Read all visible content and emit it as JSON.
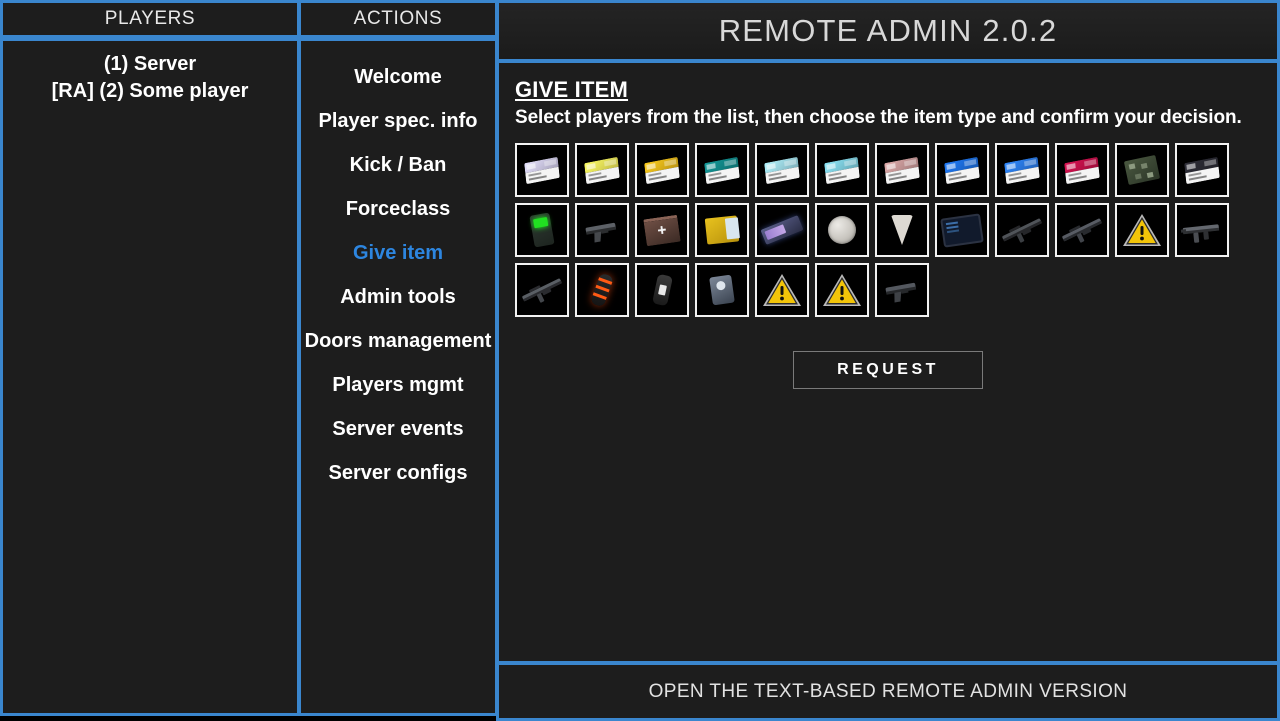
{
  "players_panel": {
    "header": "PLAYERS",
    "players": [
      {
        "label": "(1) Server"
      },
      {
        "label": "[RA] (2) Some player"
      }
    ]
  },
  "actions_panel": {
    "header": "ACTIONS",
    "items": [
      {
        "label": "Welcome",
        "active": false
      },
      {
        "label": "Player spec. info",
        "active": false
      },
      {
        "label": "Kick / Ban",
        "active": false
      },
      {
        "label": "Forceclass",
        "active": false
      },
      {
        "label": "Give item",
        "active": true
      },
      {
        "label": "Admin tools",
        "active": false
      },
      {
        "label": "Doors management",
        "active": false
      },
      {
        "label": "Players mgmt",
        "active": false
      },
      {
        "label": "Server events",
        "active": false
      },
      {
        "label": "Server configs",
        "active": false
      }
    ]
  },
  "main": {
    "title": "REMOTE ADMIN 2.0.2",
    "section_title": "GIVE ITEM",
    "section_subtitle": "Select players from the list, then choose the item type and confirm your decision.",
    "request_label": "REQUEST",
    "footer_label": "OPEN THE TEXT-BASED REMOTE ADMIN VERSION"
  },
  "theme": {
    "accent": "#3a86ce",
    "active_item": "#2d86e0",
    "panel_bg": "#1d1d1d",
    "tile_border": "#f2f2f2",
    "warning_yellow": "#f2c409"
  },
  "item_grid": {
    "columns": 12,
    "items": [
      {
        "name": "keycard-janitor",
        "art": "keycard",
        "color": "#cfcbe8"
      },
      {
        "name": "keycard-scientist",
        "art": "keycard",
        "color": "#f0e85a"
      },
      {
        "name": "keycard-research-supervisor",
        "art": "keycard",
        "color": "#e8b91a"
      },
      {
        "name": "keycard-zone-manager",
        "art": "keycard",
        "color": "#128a8a"
      },
      {
        "name": "keycard-guard",
        "art": "keycard",
        "color": "#9fdbe8"
      },
      {
        "name": "keycard-mtf-private",
        "art": "keycard",
        "color": "#7fd0e0"
      },
      {
        "name": "keycard-containment-engineer",
        "art": "keycard",
        "color": "#c99a9a"
      },
      {
        "name": "keycard-mtf-operative",
        "art": "keycard",
        "color": "#1d6fe0"
      },
      {
        "name": "keycard-mtf-captain",
        "art": "keycard",
        "color": "#2a7ae8"
      },
      {
        "name": "keycard-facility-manager",
        "art": "keycard",
        "color": "#c4104a"
      },
      {
        "name": "keycard-chaos-insurgency",
        "art": "circuit",
        "color": "#4a5840"
      },
      {
        "name": "keycard-o5",
        "art": "keycard",
        "color": "#2a2a33"
      },
      {
        "name": "radio",
        "art": "radio-green",
        "color": "#2f3a33"
      },
      {
        "name": "gun-com15",
        "art": "gun-pistol",
        "color": "#45484c"
      },
      {
        "name": "medkit",
        "art": "medkit",
        "color": "#6f4f45"
      },
      {
        "name": "adrenaline",
        "art": "adrenaline",
        "color": "#e8c21e"
      },
      {
        "name": "micro-hid",
        "art": "microhid",
        "color": "#5a5f8a"
      },
      {
        "name": "scp-2176-coin",
        "art": "coin",
        "color": "#d8d5cf"
      },
      {
        "name": "scp-207-cup",
        "art": "cup",
        "color": "#ddd9d2"
      },
      {
        "name": "tablet",
        "art": "tablet",
        "color": "#111a2c"
      },
      {
        "name": "gun-e11-sr",
        "art": "gun-rifle",
        "color": "#3b3e42"
      },
      {
        "name": "gun-crossvec",
        "art": "gun-rifle",
        "color": "#41444a"
      },
      {
        "name": "missing-texture",
        "art": "warning",
        "color": "#f2c409"
      },
      {
        "name": "gun-fsp9",
        "art": "gun-smg",
        "color": "#4a4d52"
      },
      {
        "name": "gun-logicer",
        "art": "gun-rifle",
        "color": "#43464b"
      },
      {
        "name": "grenade-frag",
        "art": "grenade-red",
        "color": "#ff5a14"
      },
      {
        "name": "grenade-flash",
        "art": "flashbang",
        "color": "#3a3a3a"
      },
      {
        "name": "radio-handheld",
        "art": "radio-blue",
        "color": "#7d8899"
      },
      {
        "name": "missing-texture",
        "art": "warning",
        "color": "#f2c409"
      },
      {
        "name": "missing-texture",
        "art": "warning",
        "color": "#f2c409"
      },
      {
        "name": "gun-com18",
        "art": "gun-pistol",
        "color": "#3e4146"
      }
    ]
  }
}
